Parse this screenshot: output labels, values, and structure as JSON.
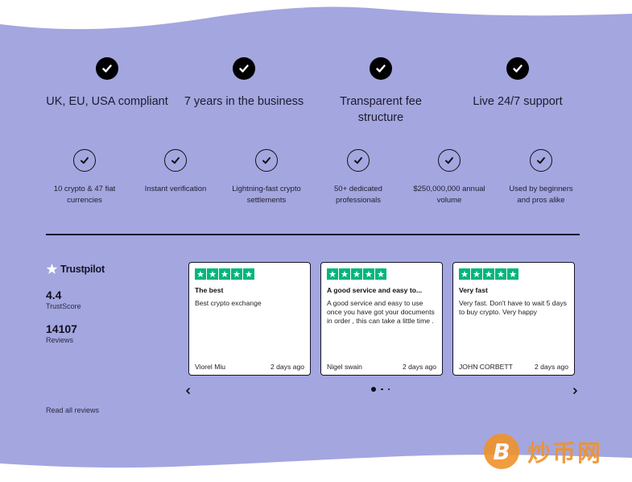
{
  "colors": {
    "background_band": "#a4a6e0",
    "page_white": "#ffffff",
    "trustpilot_green": "#00b67a",
    "watermark_orange": "#f0932b",
    "divider": "#141432"
  },
  "highlights": [
    {
      "icon": "check-circle-filled-icon",
      "label": "UK, EU, USA compliant"
    },
    {
      "icon": "check-circle-filled-icon",
      "label": "7 years in the business"
    },
    {
      "icon": "check-circle-filled-icon",
      "label": "Transparent fee structure"
    },
    {
      "icon": "check-circle-filled-icon",
      "label": "Live 24/7 support"
    }
  ],
  "features": [
    {
      "icon": "check-circle-outline-icon",
      "label": "10 crypto & 47 fiat currencies"
    },
    {
      "icon": "check-circle-outline-icon",
      "label": "Instant verification"
    },
    {
      "icon": "check-circle-outline-icon",
      "label": "Lightning-fast crypto settlements"
    },
    {
      "icon": "check-circle-outline-icon",
      "label": "50+ dedicated professionals"
    },
    {
      "icon": "check-circle-outline-icon",
      "label": "$250,000,000 annual volume"
    },
    {
      "icon": "check-circle-outline-icon",
      "label": "Used by beginners and pros alike"
    }
  ],
  "trustpilot": {
    "brand": "Trustpilot",
    "score": "4.4",
    "score_label": "TrustScore",
    "review_count": "14107",
    "review_count_label": "Reviews",
    "read_all_label": "Read all reviews"
  },
  "reviews": [
    {
      "rating": 5,
      "title": "The best",
      "body": "Best crypto exchange",
      "author": "Viorel Miu",
      "time": "2 days ago"
    },
    {
      "rating": 5,
      "title": "A good service and easy to...",
      "body": "A good service and easy to use once you have got your documents in order , this can take a little time .",
      "author": "Nigel swain",
      "time": "2 days ago"
    },
    {
      "rating": 5,
      "title": "Very fast",
      "body": "Very fast. Don't have to wait 5 days to buy crypto. Very happy",
      "author": "JOHN CORBETT",
      "time": "2 days ago"
    }
  ],
  "carousel": {
    "prev_icon": "chevron-left-icon",
    "next_icon": "chevron-right-icon",
    "page_count": 3,
    "active_page": 1
  },
  "watermark": {
    "coin_letter": "B",
    "text": "炒币网"
  }
}
